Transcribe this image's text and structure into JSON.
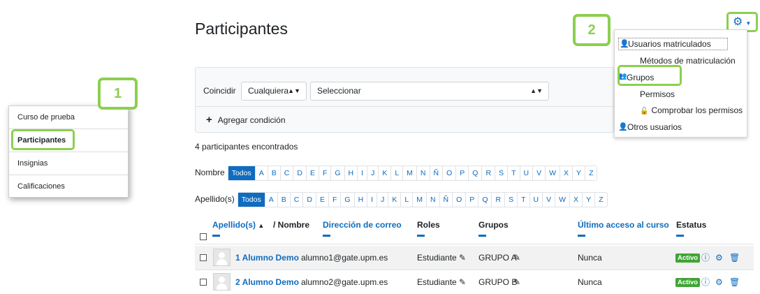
{
  "page_title": "Participantes",
  "nav": {
    "items": [
      {
        "label": "Curso de prueba"
      },
      {
        "label": "Participantes"
      },
      {
        "label": "Insignias"
      },
      {
        "label": "Calificaciones"
      }
    ]
  },
  "callouts": {
    "one": "1",
    "two": "2"
  },
  "filter": {
    "match_label": "Coincidir",
    "match_value": "Cualquiera",
    "select_value": "Seleccionar",
    "add_condition": "Agregar condición",
    "add_icon": "plus-icon"
  },
  "results_count": "4 participantes encontrados",
  "initials": {
    "first_label": "Nombre",
    "last_label": "Apellido(s)",
    "all_label": "Todos",
    "letters": [
      "A",
      "B",
      "C",
      "D",
      "E",
      "F",
      "G",
      "H",
      "I",
      "J",
      "K",
      "L",
      "M",
      "N",
      "Ñ",
      "O",
      "P",
      "Q",
      "R",
      "S",
      "T",
      "U",
      "V",
      "W",
      "X",
      "Y",
      "Z"
    ]
  },
  "table": {
    "headers": {
      "lastname": "Apellido(s)",
      "sep": "/ Nombre",
      "email": "Dirección de correo",
      "roles": "Roles",
      "groups": "Grupos",
      "lastaccess": "Último acceso al curso",
      "status": "Estatus"
    },
    "rows": [
      {
        "name": "1 Alumno Demo",
        "email": "alumno1@gate.upm.es",
        "role": "Estudiante",
        "group": "GRUPO A",
        "lastaccess": "Nunca",
        "status": "Activo"
      },
      {
        "name": "2 Alumno Demo",
        "email": "alumno2@gate.upm.es",
        "role": "Estudiante",
        "group": "GRUPO B",
        "lastaccess": "Nunca",
        "status": "Activo"
      }
    ]
  },
  "menu": {
    "items": [
      {
        "label": "Usuarios matriculados",
        "icon": "user-plus-icon"
      },
      {
        "label": "Métodos de matriculación",
        "icon": ""
      },
      {
        "label": "Grupos",
        "icon": "users-icon"
      },
      {
        "label": "Permisos",
        "icon": ""
      },
      {
        "label": "Comprobar los permisos",
        "icon": "unlock-icon"
      },
      {
        "label": "Otros usuarios",
        "icon": "user-plus-icon"
      }
    ]
  },
  "colors": {
    "accent": "#0f6cbf",
    "highlight": "#8ccf50",
    "active_badge": "#3fa535"
  }
}
